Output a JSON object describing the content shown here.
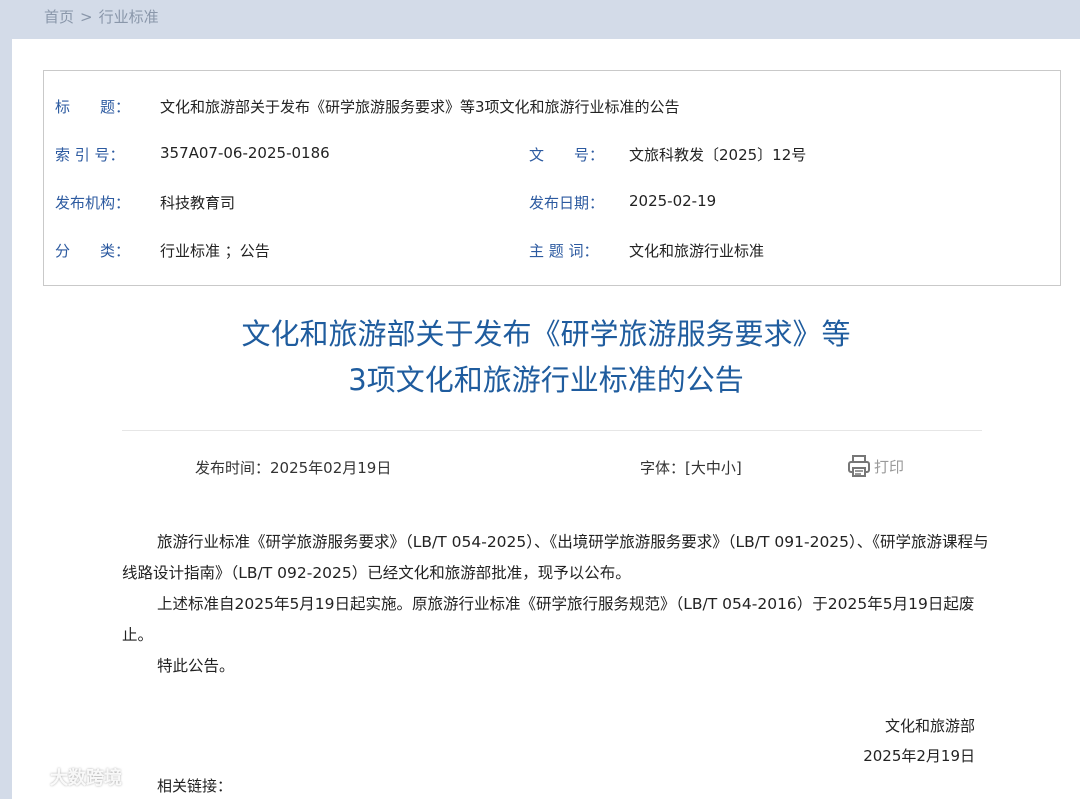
{
  "breadcrumb": {
    "home": "首页",
    "separator": ">",
    "current": "行业标准"
  },
  "meta": {
    "title_label": "标　　题：",
    "title_value": "文化和旅游部关于发布《研学旅游服务要求》等3项文化和旅游行业标准的公告",
    "index_label": "索 引 号：",
    "index_value": "357A07-06-2025-0186",
    "docno_label": "文　　号：",
    "docno_value": "文旅科教发〔2025〕12号",
    "org_label": "发布机构：",
    "org_value": "科技教育司",
    "date_label": "发布日期：",
    "date_value": "2025-02-19",
    "category_label": "分　　类：",
    "category_value": "行业标准 ；公告",
    "keywords_label": "主 题 词：",
    "keywords_value": "文化和旅游行业标准"
  },
  "article": {
    "title_line1": "文化和旅游部关于发布《研学旅游服务要求》等",
    "title_line2": "3项文化和旅游行业标准的公告",
    "publish_time": "发布时间：2025年02月19日",
    "font_size_label": "字体：[大中小]",
    "print_label": "打印",
    "paragraphs": [
      "旅游行业标准《研学旅游服务要求》（LB/T 054-2025）、《出境研学旅游服务要求》（LB/T 091-2025）、《研学旅游课程与线路设计指南》（LB/T 092-2025）已经文化和旅游部批准，现予以公布。",
      "上述标准自2025年5月19日起实施。原旅游行业标准《研学旅行服务规范》（LB/T 054-2016）于2025年5月19日起废止。",
      "特此公告。"
    ],
    "signature_org": "文化和旅游部",
    "signature_date": "2025年2月19日",
    "related_links": "相关链接："
  },
  "watermark": {
    "text": "大数跨境"
  },
  "colors": {
    "label_blue": "#2c5aa0",
    "title_blue": "#1f5c9e",
    "background": "#d3dbe8"
  }
}
